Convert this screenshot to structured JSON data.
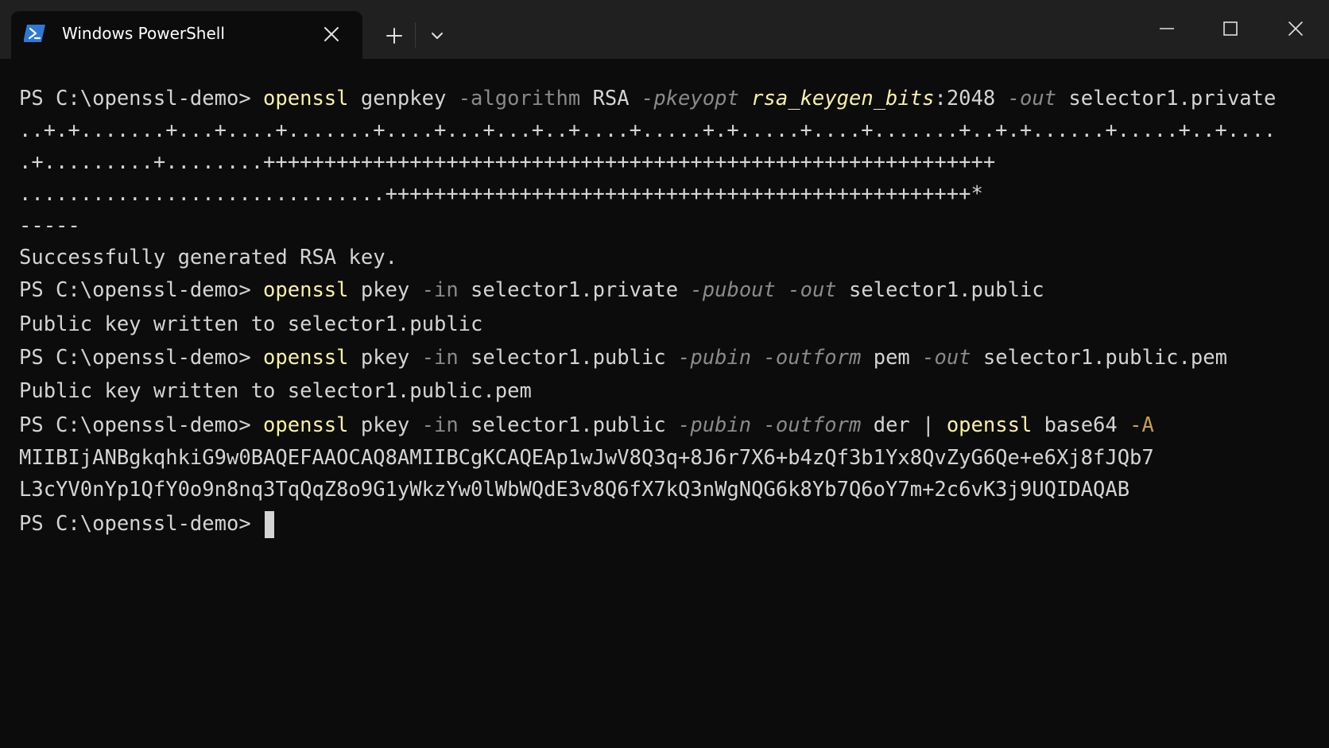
{
  "window": {
    "tab_title": "Windows PowerShell",
    "icons": {
      "app": "powershell-icon",
      "tab_close": "close-icon",
      "new_tab": "plus-icon",
      "dropdown": "chevron-down-icon",
      "minimize": "minimize-icon",
      "maximize": "maximize-icon",
      "close": "close-icon"
    },
    "colors": {
      "titlebar": "#202020",
      "background": "#0c0c0c",
      "command": "#f9f1a5",
      "parameter": "#8a8a8a",
      "text": "#d4d4d4",
      "icon_blue": "#2f78d6"
    }
  },
  "terminal": {
    "prompt": "PS C:\\openssl-demo> ",
    "line1": {
      "cmd": "openssl",
      "sub": " genpkey ",
      "p1": "-algorithm",
      "v1": " RSA ",
      "p2": "-pkeyopt",
      "sp": " ",
      "v2": "rsa_keygen_bits",
      "v3": ":2048 ",
      "p3": "-out",
      "v4": " selector1.private"
    },
    "progress1": "..+.+.......+...+....+.......+....+...+...+..+....+.....+.+.....+....+.......+..+.+......+.....+..+....",
    "progress2": ".+.........+........++++++++++++++++++++++++++++++++++++++++++++++++++++++++++++",
    "progress3": "..............................++++++++++++++++++++++++++++++++++++++++++++++++*",
    "dashes": "-----",
    "success": "Successfully generated RSA key.",
    "line2": {
      "cmd": "openssl",
      "sub": " pkey ",
      "p1": "-in",
      "v1": " selector1.private ",
      "p2": "-pubout",
      "sp": " ",
      "p3": "-out",
      "v2": " selector1.public"
    },
    "written1": "Public key written to selector1.public",
    "line3": {
      "cmd": "openssl",
      "sub": " pkey ",
      "p1": "-in",
      "v1": " selector1.public ",
      "p2": "-pubin",
      "sp": " ",
      "p3": "-outform",
      "v2": " pem ",
      "p4": "-out",
      "v3": " selector1.public.pem"
    },
    "written2": "Public key written to selector1.public.pem",
    "line4": {
      "cmd": "openssl",
      "sub": " pkey ",
      "p1": "-in",
      "v1": " selector1.public ",
      "p2": "-pubin",
      "sp": " ",
      "p3": "-outform",
      "v2": " der | ",
      "cmd2": "openssl",
      "v3": " base64 ",
      "p4": "-A"
    },
    "b64_1": "MIIBIjANBgkqhkiG9w0BAQEFAAOCAQ8AMIIBCgKCAQEAp1wJwV8Q3q+8J6r7X6+b4zQf3b1Yx8QvZyG6Qe+e6Xj8fJQb7",
    "b64_2": "L3cYV0nYp1QfY0o9n8nq3TqQqZ8o9G1yWkzYw0lWbWQdE3v8Q6fX7kQ3nWgNQG6k8Yb7Q6oY7m+2c6vK3j9UQIDAQAB"
  }
}
